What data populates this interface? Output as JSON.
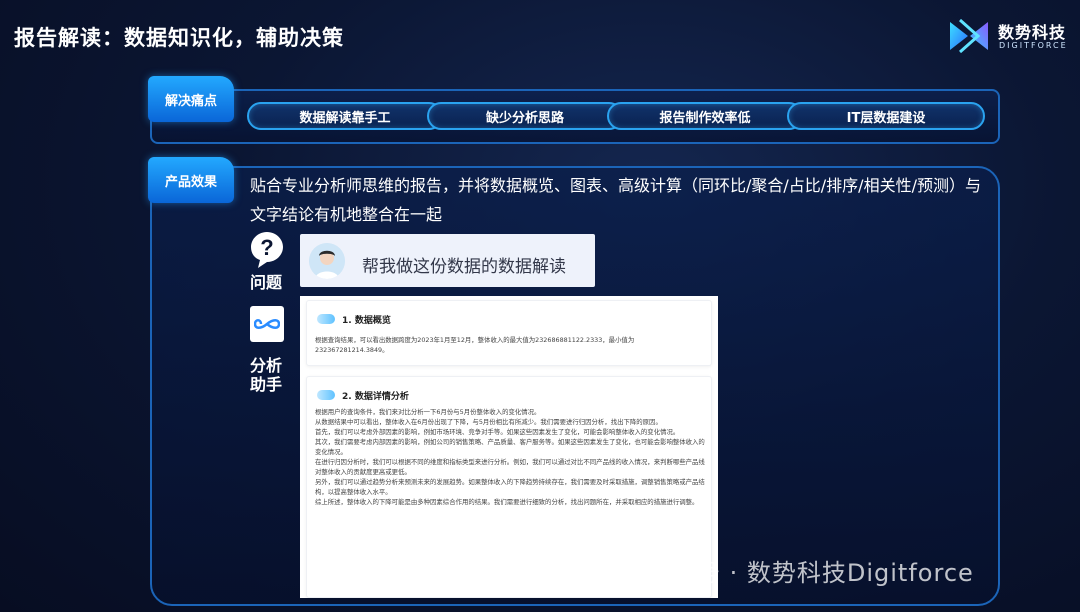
{
  "header": {
    "title": "报告解读：数据知识化，辅助决策"
  },
  "logo": {
    "name": "数势科技",
    "subtitle": "DIGITFORCE"
  },
  "pain_points": {
    "tag": "解决痛点",
    "items": [
      "数据解读靠手工",
      "缺少分析思路",
      "报告制作效率低",
      "IT层数据建设"
    ]
  },
  "effect": {
    "tag": "产品效果",
    "description": "贴合专业分析师思维的报告，并将数据概览、图表、高级计算（同环比/聚合/占比/排序/相关性/预测）与文字结论有机地整合在一起",
    "question_label": "问题",
    "assistant_label": "分析助手",
    "question_text": "帮我做这份数据的数据解读"
  },
  "report": {
    "section1": {
      "title": "1. 数据概览",
      "body": "根据查询结果，可以看出数据跨度为2023年1月至12月，整体收入的最大值为232686881122.2333，最小值为232367281214.3849。"
    },
    "section2": {
      "title": "2. 数据详情分析",
      "paragraphs": [
        "根据用户的查询条件，我们来对比分析一下6月份与5月份整体收入的变化情况。",
        "从数据结果中可以看出，整体收入在6月份出现了下降，与5月份相比有所减少。我们需要进行归因分析，找出下降的原因。",
        "首先，我们可以考虑外部因素的影响，例如市场环境、竞争对手等。如果这些因素发生了变化，可能会影响整体收入的变化情况。",
        "其次，我们需要考虑内部因素的影响，例如公司的销售策略、产品质量、客户服务等。如果这些因素发生了变化，也可能会影响整体收入的变化情况。",
        "在进行归因分析时，我们可以根据不同的维度和指标类型来进行分析。例如，我们可以通过对比不同产品线的收入情况，来判断哪些产品线对整体收入的贡献度更高或更低。",
        "另外，我们可以通过趋势分析来预测未来的发展趋势。如果整体收入的下降趋势持续存在，我们需要及时采取措施，调整销售策略或产品结构，以提高整体收入水平。",
        "综上所述，整体收入的下降可能是由多种因素综合作用的结果。我们需要进行细致的分析，找出问题所在，并采取相应的措施进行调整。"
      ]
    }
  },
  "watermark": {
    "text": "公众号 · 数势科技Digitforce"
  }
}
